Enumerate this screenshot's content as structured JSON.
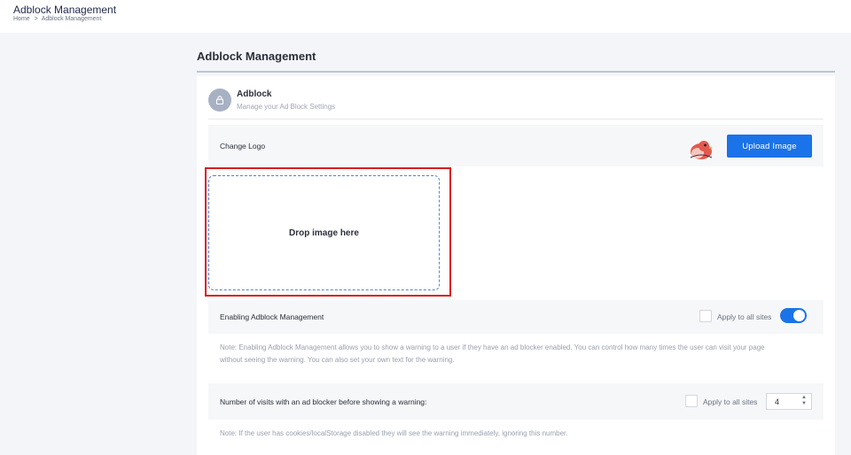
{
  "header": {
    "app_title": "Adblock Management",
    "breadcrumb": [
      "Home",
      ">",
      "Adblock Management"
    ]
  },
  "page": {
    "title": "Adblock Management"
  },
  "section": {
    "name": "Adblock",
    "subtitle": "Manage your Ad Block Settings",
    "icon": "lock-icon"
  },
  "logo": {
    "label": "Change Logo",
    "upload_label": "Upload Image",
    "drop_text": "Drop image here",
    "preview_icon": "bird-logo-icon"
  },
  "enable": {
    "label": "Enabling Adblock Management",
    "apply_label": "Apply to all sites",
    "apply_checked": false,
    "toggle_on": true,
    "note_line1": "Note: Enabling Adblock Management allows you to show a warning to a user if they have an ad blocker enabled. You can control how many times the user can visit your page",
    "note_line2": "without seeing the warning. You can also set your own text for the warning."
  },
  "visits": {
    "label": "Number of visits with an ad blocker before showing a warning:",
    "apply_label": "Apply to all sites",
    "apply_checked": false,
    "value": "4",
    "note": "Note: If the user has cookies/localStorage disabled they will see the warning immediately, ignoring this number."
  },
  "colors": {
    "accent": "#1a73e8",
    "highlight_border": "#d91c1c",
    "page_bg": "#f4f5f8"
  }
}
